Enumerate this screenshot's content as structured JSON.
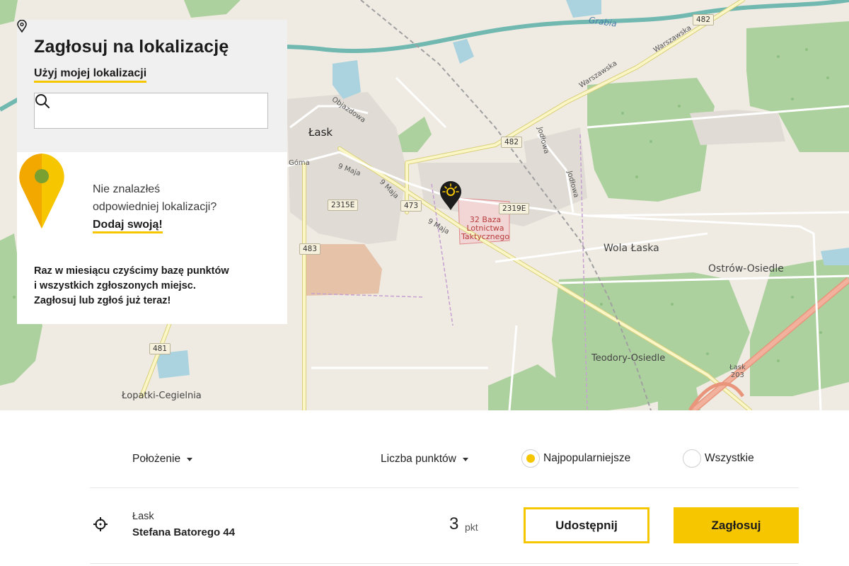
{
  "panel": {
    "title": "Zagłosuj na lokalizację",
    "use_location_label": "Użyj mojej lokalizacji",
    "search_placeholder": "",
    "missing_line1": "Nie znalazłeś",
    "missing_line2": "odpowiedniej lokalizacji?",
    "add_own_label": "Dodaj swoją!",
    "info_line1": "Raz w miesiącu czyścimy bazę punktów",
    "info_line2": "i wszystkich zgłoszonych miejsc.",
    "info_line3": "Zagłosuj lub zgłoś już teraz!"
  },
  "map": {
    "labels": {
      "lask": "Łask",
      "wola_laska": "Wola Łaska",
      "ostrow": "Ostrów-Osiedle",
      "teodory": "Teodory-Osiedle",
      "lopatki": "Łopatki-Cegielnia",
      "grabia": "Grabia",
      "warszawska1": "Warszawska",
      "warszawska2": "Warszawska",
      "objazdowa": "Objazdowa",
      "goma": "Góma",
      "maja1": "9 Maja",
      "maja2": "9 Maja",
      "maja3": "9 Maja",
      "jodlowa1": "Jodłowa",
      "jodlowa2": "Jodłowa",
      "zone_line1": "32 Baza",
      "zone_line2": "Lotnictwa",
      "zone_line3": "Taktycznego",
      "lask203_line1": "Łask",
      "lask203_line2": "203"
    },
    "shields": {
      "r482a": "482",
      "r482b": "482",
      "r473": "473",
      "r2315": "2315E",
      "r2319": "2319E",
      "r483": "483",
      "r481": "481"
    }
  },
  "filters": {
    "location_label": "Położenie",
    "points_label": "Liczba punktów",
    "popular_label": "Najpopularniejsze",
    "all_label": "Wszystkie",
    "selected": "Najpopularniejsze"
  },
  "rows": [
    {
      "city": "Łask",
      "street": "Stefana Batorego 44",
      "points": "3",
      "points_unit": "pkt",
      "share_label": "Udostępnij",
      "vote_label": "Zagłosuj"
    }
  ],
  "colors": {
    "accent": "#f6c600",
    "forest": "#add19e",
    "water": "#aad3df",
    "map_bg": "#efebe3"
  }
}
